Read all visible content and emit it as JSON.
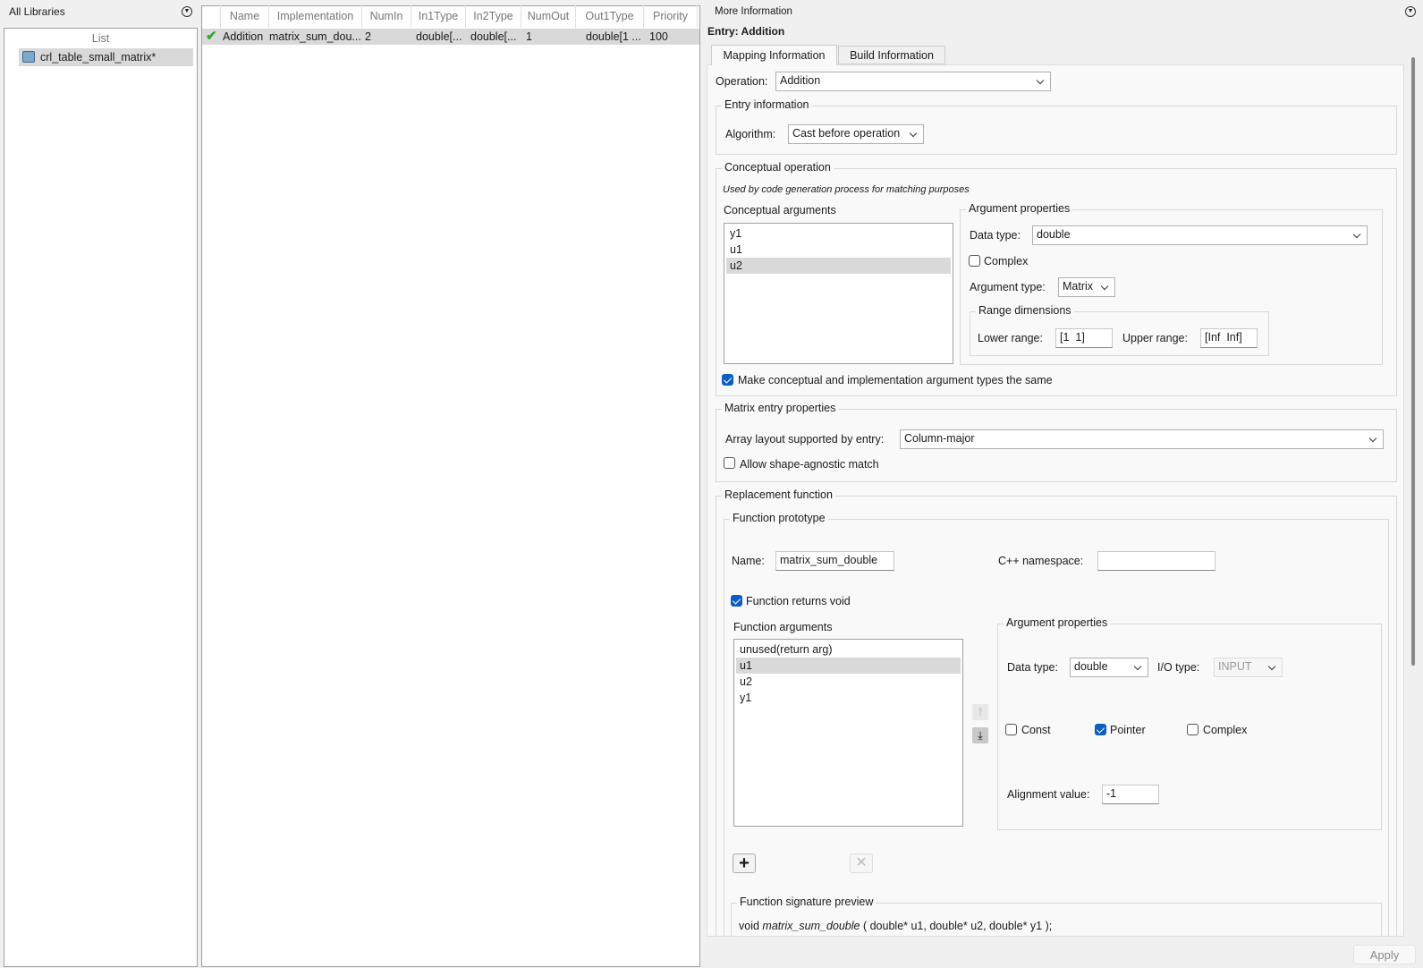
{
  "left": {
    "title": "All Libraries",
    "list_header": "List",
    "items": [
      "crl_table_small_matrix*"
    ]
  },
  "table": {
    "columns": [
      "Name",
      "Implementation",
      "NumIn",
      "In1Type",
      "In2Type",
      "NumOut",
      "Out1Type",
      "Priority"
    ],
    "rows": [
      [
        "Addition",
        "matrix_sum_dou...",
        "2",
        "double[...",
        "double[...",
        "1",
        "double[1 ...",
        "100"
      ]
    ]
  },
  "right": {
    "title": "More Information",
    "entry": "Entry: Addition",
    "tabs": [
      "Mapping Information",
      "Build Information"
    ],
    "operation_label": "Operation:",
    "operation": "Addition",
    "entry_info": {
      "title": "Entry information",
      "algorithm_label": "Algorithm:",
      "algorithm": "Cast before operation"
    },
    "conceptual": {
      "title": "Conceptual operation",
      "note": "Used by code generation process for matching purposes",
      "args_label": "Conceptual arguments",
      "args": [
        "y1",
        "u1",
        "u2"
      ],
      "props_title": "Argument properties",
      "data_type_label": "Data type:",
      "data_type": "double",
      "complex_label": "Complex",
      "arg_type_label": "Argument type:",
      "arg_type": "Matrix",
      "range_title": "Range dimensions",
      "lower_label": "Lower range:",
      "lower": "[1  1]",
      "upper_label": "Upper range:",
      "upper": "[Inf  Inf]",
      "same_label": "Make conceptual and implementation argument types the same"
    },
    "matrix": {
      "title": "Matrix entry properties",
      "layout_label": "Array layout supported by entry:",
      "layout": "Column-major",
      "shape_label": "Allow shape-agnostic match"
    },
    "replacement": {
      "title": "Replacement function",
      "proto_title": "Function prototype",
      "name_label": "Name:",
      "name": "matrix_sum_double",
      "ns_label": "C++ namespace:",
      "ns": "",
      "void_label": "Function returns void",
      "args_label": "Function arguments",
      "args": [
        "unused(return arg)",
        "u1",
        "u2",
        "y1"
      ],
      "props_title": "Argument properties",
      "data_type_label": "Data type:",
      "data_type": "double",
      "io_label": "I/O type:",
      "io": "INPUT",
      "const_label": "Const",
      "pointer_label": "Pointer",
      "complex_label": "Complex",
      "align_label": "Alignment value:",
      "align": "-1",
      "sig_title": "Function signature preview",
      "sig_pre": "void ",
      "sig_fn": "matrix_sum_double",
      "sig_post": " ( double* u1, double* u2, double* y1 );"
    },
    "apply": "Apply"
  }
}
